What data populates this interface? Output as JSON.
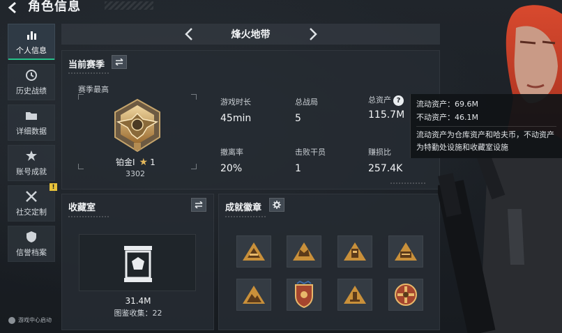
{
  "header": {
    "title": "角色信息"
  },
  "sidebar": {
    "items": [
      {
        "label": "个人信息",
        "icon": "bar-chart-icon",
        "active": true
      },
      {
        "label": "历史战绩",
        "icon": "history-icon",
        "active": false
      },
      {
        "label": "详细数据",
        "icon": "folder-icon",
        "active": false
      },
      {
        "label": "账号成就",
        "icon": "achievement-icon",
        "active": false
      },
      {
        "label": "社交定制",
        "icon": "tools-icon",
        "active": false,
        "badge": "!"
      },
      {
        "label": "信誉档案",
        "icon": "shield-icon",
        "active": false
      }
    ],
    "footer": "游戏中心启动"
  },
  "mode_bar": {
    "name": "烽火地带"
  },
  "season": {
    "title": "当前赛季",
    "best_label": "赛季最高",
    "rank_name": "铂金I",
    "rank_stars": "1",
    "rank_score": "3302",
    "stats": [
      {
        "label": "游戏时长",
        "value": "45min"
      },
      {
        "label": "总战局",
        "value": "5"
      },
      {
        "label": "总资产",
        "value": "115.7M",
        "has_help": true
      },
      {
        "label": "撤离率",
        "value": "20%"
      },
      {
        "label": "击败干员",
        "value": "1"
      },
      {
        "label": "赚损比",
        "value": "257.4K"
      }
    ],
    "help_glyph": "?"
  },
  "tooltip": {
    "liquid": "流动资产：69.6M",
    "fixed": "不动资产：46.1M",
    "desc": "流动资产为仓库资产和哈夫币，不动资产为特勤处设施和收藏室设施"
  },
  "collection": {
    "title": "收藏室",
    "value": "31.4M",
    "count": "图鉴收集：22"
  },
  "achievements": {
    "title": "成就徽章",
    "badges": [
      "hill-badge-icon",
      "crown-badge-icon",
      "tower-badge-icon",
      "speed-badge-icon",
      "mountain-badge-icon",
      "shield-badge-icon",
      "pillar-badge-icon",
      "cross-badge-icon"
    ]
  },
  "colors": {
    "accent": "#27c28a",
    "gold": "#c9903a",
    "warn": "#e8c23a"
  }
}
